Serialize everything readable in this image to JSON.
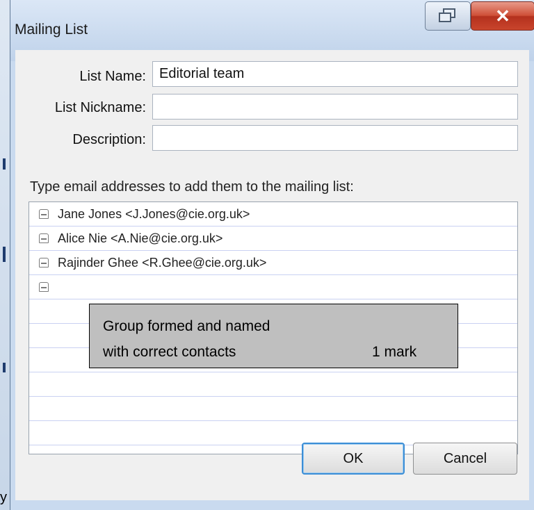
{
  "window": {
    "title": "Mailing List"
  },
  "form": {
    "list_name_label": "List Name:",
    "list_name_value": "Editorial team",
    "list_nickname_label": "List Nickname:",
    "list_nickname_value": "",
    "description_label": "Description:",
    "description_value": ""
  },
  "list": {
    "instruction": "Type email addresses to add them to the mailing list:",
    "members": [
      "Jane Jones <J.Jones@cie.org.uk>",
      "Alice Nie <A.Nie@cie.org.uk>",
      "Rajinder Ghee <R.Ghee@cie.org.uk>"
    ]
  },
  "annotation": {
    "line1": "Group formed and named",
    "line2": "with correct contacts",
    "mark": "1 mark"
  },
  "buttons": {
    "ok": "OK",
    "cancel": "Cancel"
  },
  "stray_char": "y",
  "colors": {
    "window_frame": "#c9daef",
    "close_button": "#c9452c",
    "ok_focus": "#3c8ed6",
    "note_background": "#bfbfbf"
  }
}
